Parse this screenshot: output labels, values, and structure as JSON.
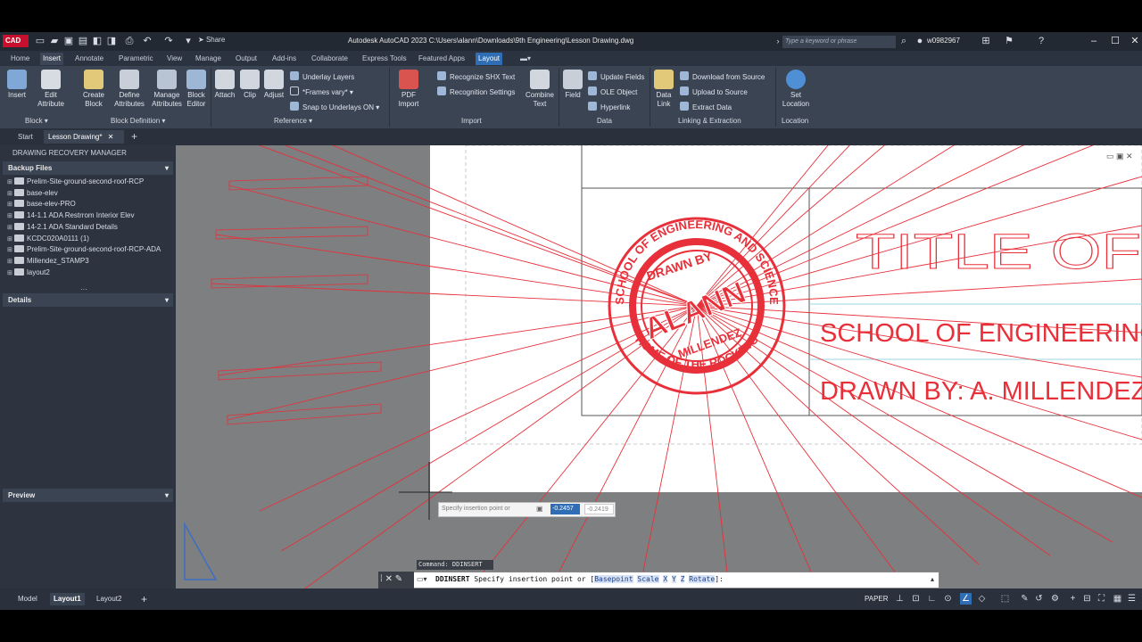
{
  "app": {
    "logo": "CAD",
    "title": "Autodesk AutoCAD 2023    C:\\Users\\alann\\Downloads\\9th Engineering\\Lesson Drawing.dwg",
    "share_label": "Share",
    "search_placeholder": "Type a keyword or phrase",
    "username": "w0982967"
  },
  "ribbon_tabs": [
    "Home",
    "Insert",
    "Annotate",
    "Parametric",
    "View",
    "Manage",
    "Output",
    "Add-ins",
    "Collaborate",
    "Express Tools",
    "Featured Apps",
    "Layout"
  ],
  "ribbon": {
    "insert": "Insert",
    "edit_attribute": "Edit Attribute",
    "create_block": "Create Block",
    "define_attributes": "Define Attributes",
    "manage_attributes": "Manage Attributes",
    "block_editor": "Block Editor",
    "attach": "Attach",
    "clip": "Clip",
    "adjust": "Adjust",
    "underlay_layers": "Underlay Layers",
    "frames_vary": "*Frames vary*",
    "snap_underlays": "Snap to Underlays ON",
    "pdf_import": "PDF Import",
    "recognize_shx": "Recognize SHX Text",
    "recognition_settings": "Recognition Settings",
    "combine_text": "Combine Text",
    "field": "Field",
    "update_fields": "Update Fields",
    "ole_object": "OLE Object",
    "hyperlink": "Hyperlink",
    "data_link": "Data Link",
    "download_source": "Download from Source",
    "upload_source": "Upload to Source",
    "extract_data": "Extract  Data",
    "set_location": "Set Location",
    "panels": {
      "block": "Block",
      "block_definition": "Block Definition",
      "reference": "Reference",
      "import": "Import",
      "data": "Data",
      "linking": "Linking & Extraction",
      "location": "Location"
    }
  },
  "file_tabs": {
    "start": "Start",
    "lesson": "Lesson Drawing*"
  },
  "recovery": {
    "title": "DRAWING RECOVERY MANAGER",
    "backup_header": "Backup Files",
    "files": [
      "Prelim-Site-ground-second-roof-RCP",
      "base-elev",
      "base-elev-PRO",
      "14-1.1 ADA Restrrom Interior Elev",
      "14-2.1 ADA Standard Details",
      "KCDC020A0111 (1)",
      "Prelim-Site-ground-second-roof-RCP-ADA",
      "Millendez_STAMP3",
      "layout2"
    ],
    "details_header": "Details",
    "preview_header": "Preview"
  },
  "drawing": {
    "stamp_top": "SCHOOL OF ENGINEERING AND SCIENCE",
    "stamp_bottom": "HOME OF THE ROCKETS",
    "stamp_drawn": "DRAWN BY",
    "stamp_name": "ALANN",
    "stamp_surname": "MILLENDEZ",
    "title_outline": "TITLE OF",
    "school": "SCHOOL OF ENGINEERING",
    "drawn_by": "DRAWN BY: A. MILLENDEZ",
    "accent": "#e8303a"
  },
  "command": {
    "history": "Command: DDINSERT",
    "cmd": "DDINSERT",
    "prompt": " Specify insertion point or [",
    "opt1": "Basepoint",
    "opt2": "Scale",
    "opt3": "X",
    "opt4": "Y",
    "opt5": "Z",
    "opt6": "Rotate",
    "end": "]:",
    "tip_prompt": "Specify insertion point or",
    "x_value": "-0.2457",
    "y_value": "-0.2419"
  },
  "status": {
    "model": "Model",
    "layout1": "Layout1",
    "layout2": "Layout2",
    "paper": "PAPER"
  }
}
